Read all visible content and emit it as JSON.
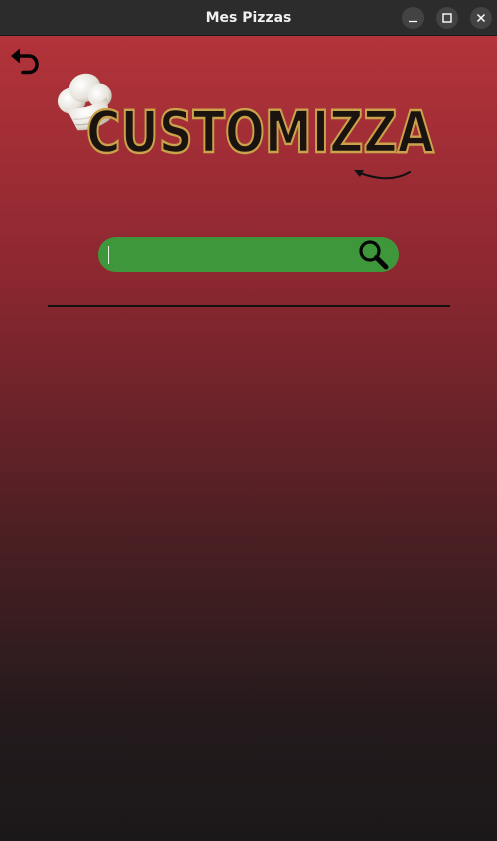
{
  "window": {
    "title": "Mes Pizzas",
    "controls": [
      "minimize-icon",
      "maximize-icon",
      "close-icon"
    ]
  },
  "toolbar": {
    "back_icon": "undo-arrow-icon"
  },
  "logo": {
    "text": "CUSTOMIZZA",
    "icon": "chef-hat-icon"
  },
  "search": {
    "value": "",
    "placeholder": "",
    "icon": "search-icon"
  },
  "colors": {
    "gradient_top": "#b3333a",
    "gradient_bottom": "#1b1819",
    "search_green": "#3f973c",
    "logo_gold": "#c9a24a",
    "titlebar": "#2c2c2c"
  }
}
